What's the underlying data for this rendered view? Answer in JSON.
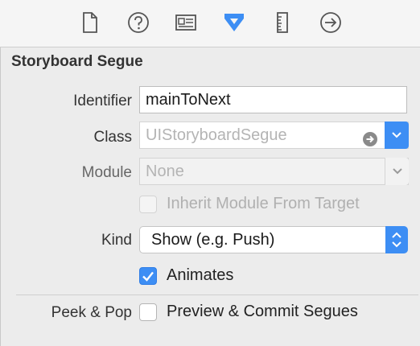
{
  "toolbar": {
    "icons": [
      "file-icon",
      "help-icon",
      "identity-card-icon",
      "attributes-arrow-icon",
      "ruler-icon",
      "connections-arrow-icon"
    ],
    "selected": "attributes-arrow-icon",
    "accent": "#3d8ef4"
  },
  "section": {
    "title": "Storyboard Segue"
  },
  "identifier": {
    "label": "Identifier",
    "value": "mainToNext"
  },
  "class": {
    "label": "Class",
    "placeholder": "UIStoryboardSegue"
  },
  "module": {
    "label": "Module",
    "placeholder": "None"
  },
  "inherit": {
    "label": "Inherit Module From Target",
    "checked": false,
    "enabled": false
  },
  "kind": {
    "label": "Kind",
    "value": "Show (e.g. Push)"
  },
  "animates": {
    "label": "Animates",
    "checked": true
  },
  "peek_pop": {
    "label": "Peek & Pop",
    "option_label": "Preview & Commit Segues",
    "checked": false
  }
}
